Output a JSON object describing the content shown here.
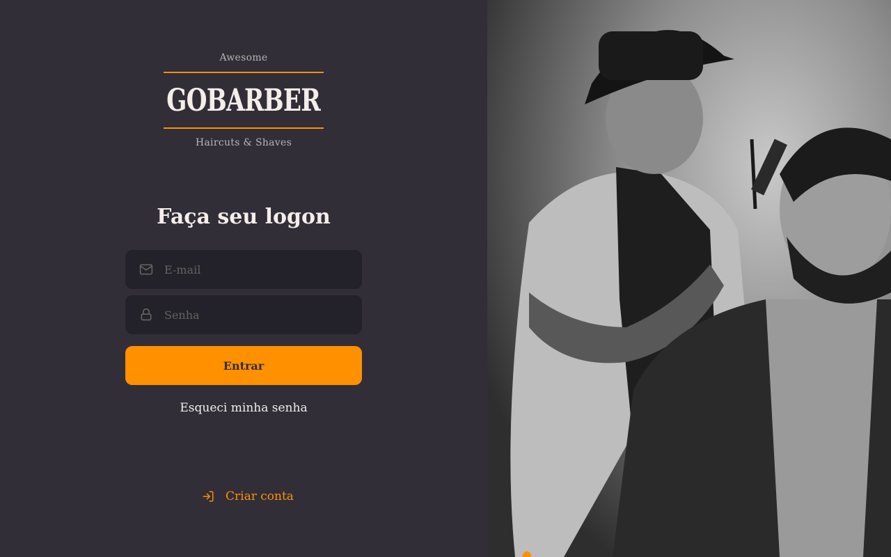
{
  "logo": {
    "top": "Awesome",
    "main": "GOBARBER",
    "bottom": "Haircuts & Shaves"
  },
  "form": {
    "title": "Faça seu logon",
    "email_placeholder": "E-mail",
    "password_placeholder": "Senha",
    "submit_label": "Entrar",
    "forgot_label": "Esqueci minha senha"
  },
  "footer": {
    "create_account_label": "Criar conta"
  },
  "icons": {
    "email": "mail-icon",
    "password": "lock-icon",
    "create": "log-in-icon"
  },
  "colors": {
    "background": "#312e38",
    "input_bg": "#232129",
    "accent": "#ff9000",
    "text": "#f4ede8",
    "placeholder": "#666360"
  }
}
